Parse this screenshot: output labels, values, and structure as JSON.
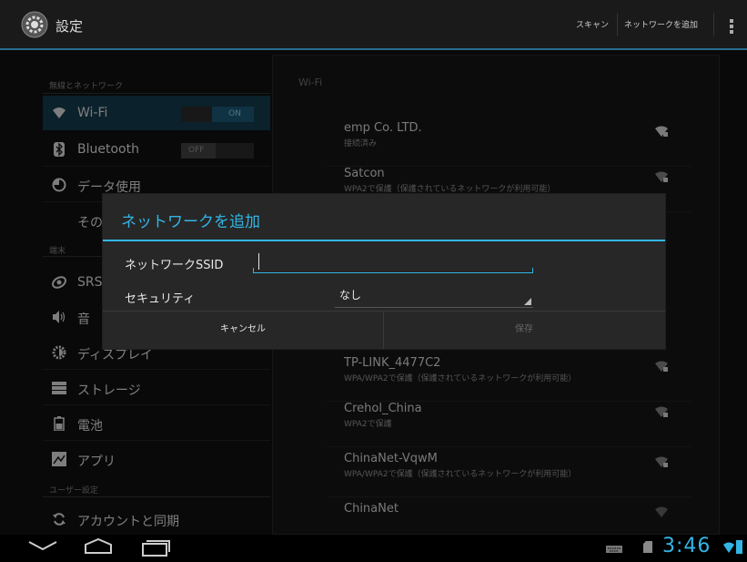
{
  "actionbar": {
    "title": "設定",
    "scan_label": "スキャン",
    "add_network_label": "ネットワークを追加"
  },
  "settings": {
    "section_wireless": "無線とネットワーク",
    "section_device": "端末",
    "section_user": "ユーザー設定",
    "items": [
      {
        "label": "Wi-Fi",
        "icon": "wifi-icon"
      },
      {
        "label": "Bluetooth",
        "icon": "bluetooth-icon"
      },
      {
        "label": "データ使用",
        "icon": "data-usage-icon"
      },
      {
        "label": "その"
      },
      {
        "label": "SRS",
        "icon": "srs-icon"
      },
      {
        "label": "音",
        "icon": "sound-icon"
      },
      {
        "label": "ディスプレイ",
        "icon": "display-icon"
      },
      {
        "label": "ストレージ",
        "icon": "storage-icon"
      },
      {
        "label": "電池",
        "icon": "battery-icon"
      },
      {
        "label": "アプリ",
        "icon": "apps-icon"
      },
      {
        "label": "アカウントと同期",
        "icon": "sync-icon"
      }
    ],
    "wifi_toggle": "ON",
    "bluetooth_toggle": "OFF"
  },
  "wifi_panel": {
    "title": "Wi-Fi",
    "networks": [
      {
        "ssid": "emp Co. LTD.",
        "status": "接続済み"
      },
      {
        "ssid": "Satcon",
        "status": "WPA2で保護（保護されているネットワークが利用可能）"
      },
      {
        "ssid": "TP-LINK_4477C2",
        "status": "WPA/WPA2で保護（保護されているネットワークが利用可能）"
      },
      {
        "ssid": "Crehol_China",
        "status": "WPA2で保護"
      },
      {
        "ssid": "ChinaNet-VqwM",
        "status": "WPA/WPA2で保護（保護されているネットワークが利用可能）"
      },
      {
        "ssid": "ChinaNet",
        "status": ""
      }
    ]
  },
  "dialog": {
    "title": "ネットワークを追加",
    "ssid_label": "ネットワークSSID",
    "ssid_value": "",
    "security_label": "セキュリティ",
    "security_value": "なし",
    "cancel_label": "キャンセル",
    "save_label": "保存"
  },
  "statusbar": {
    "time": "3:46"
  },
  "colors": {
    "accent": "#33b5e5",
    "background": "#121212"
  }
}
